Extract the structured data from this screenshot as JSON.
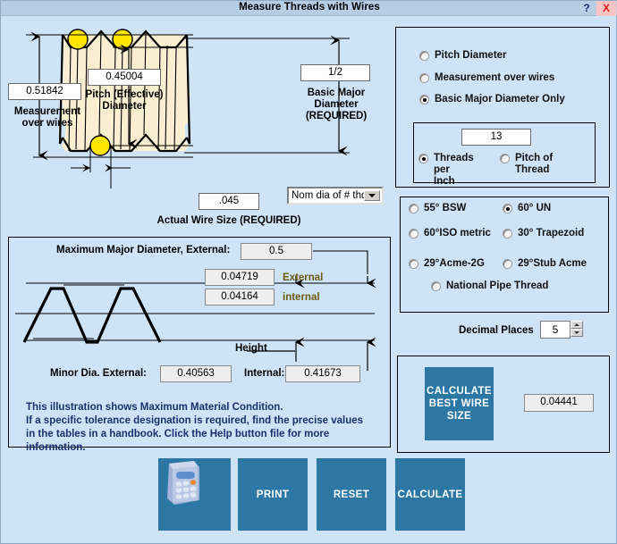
{
  "window": {
    "title": "Measure Threads with Wires",
    "help_label": "?",
    "close_label": "X"
  },
  "diagram_top": {
    "measurement_over_wires": {
      "value": "0.51842",
      "label_line1": "Measurement",
      "label_line2": "over wires"
    },
    "pitch_diameter": {
      "value": "0.45004",
      "label_line1": "Pitch (Effective)",
      "label_line2": "Diameter"
    },
    "basic_major_diameter": {
      "value": "1/2",
      "label_line1": "Basic Major",
      "label_line2": "Diameter",
      "label_line3": "(REQUIRED)"
    },
    "actual_wire_size": {
      "value": ".045",
      "label": "Actual Wire Size (REQUIRED)"
    },
    "size_mode_dropdown": {
      "selected": "Nom dia of # thds",
      "options": [
        "Nom dia of # thds"
      ]
    }
  },
  "illustration": {
    "max_major_diameter_label": "Maximum Major Diameter, External:",
    "max_major_diameter_value": "0.5",
    "external_height_value": "0.04719",
    "external_height_label": "External",
    "internal_height_value": "0.04164",
    "internal_height_label": "internal",
    "height_label": "Height",
    "minor_dia_external_label": "Minor Dia. External:",
    "minor_dia_external_value": "0.40563",
    "minor_dia_internal_label": "Internal:",
    "minor_dia_internal_value": "0.41673",
    "note_line1": "This illustration shows Maximum Material Condition.",
    "note_line2": "If a specific tolerance designation is required, find the precise values",
    "note_line3": "in the tables in a handbook. Click the Help button file for more",
    "note_line4": "information."
  },
  "known_value_group": {
    "options": [
      {
        "label": "Pitch Diameter",
        "selected": false
      },
      {
        "label": "Measurement over wires",
        "selected": false
      },
      {
        "label": "Basic Major Diameter Only",
        "selected": true
      }
    ]
  },
  "pitch_group": {
    "value": "13",
    "options": [
      {
        "label_line1": "Threads per",
        "label_line2": "Inch",
        "selected": true
      },
      {
        "label_line1": "Pitch of",
        "label_line2": "Thread",
        "selected": false
      }
    ]
  },
  "thread_form_group": {
    "options": [
      {
        "label": "55° BSW",
        "selected": false
      },
      {
        "label": "60° UN",
        "selected": true
      },
      {
        "label": "60°ISO metric",
        "selected": false
      },
      {
        "label": "30° Trapezoid",
        "selected": false
      },
      {
        "label": "29°Acme-2G",
        "selected": false
      },
      {
        "label": "29°Stub Acme",
        "selected": false
      },
      {
        "label": "National Pipe Thread",
        "selected": false
      }
    ]
  },
  "decimal_places": {
    "label": "Decimal Places",
    "value": "5"
  },
  "best_wire": {
    "button_line1": "CALCULATE",
    "button_line2": "BEST WIRE",
    "button_line3": "SIZE",
    "result": "0.04441"
  },
  "action_buttons": [
    {
      "name": "calculator",
      "label": ""
    },
    {
      "name": "print",
      "label": "PRINT"
    },
    {
      "name": "reset",
      "label": "RESET"
    },
    {
      "name": "calculate",
      "label": "CALCULATE"
    }
  ],
  "colors": {
    "background": "#cfe3f7",
    "titlebar": "#b7cde4",
    "button_blue": "#2d77a4",
    "wire_yellow": "#ffe600",
    "thread_body": "#fbefd2",
    "close_red": "#e01b1b",
    "note_navy": "#17316b"
  }
}
